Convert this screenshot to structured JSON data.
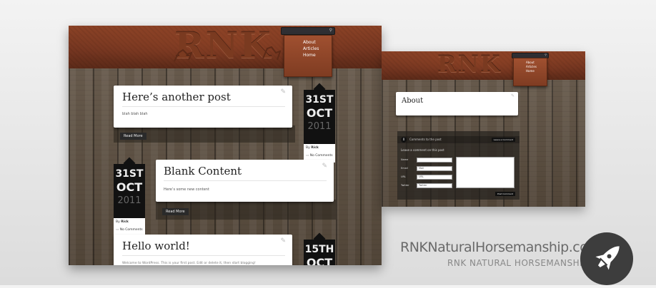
{
  "main_screenshot": {
    "logo": "RNK",
    "search": {
      "placeholder": ""
    },
    "nav": [
      "About",
      "Articles",
      "Home"
    ],
    "posts": [
      {
        "title": "Here’s another post",
        "excerpt": "blah blah blah",
        "read_more": "Read More",
        "date": {
          "day": "31ST",
          "month": "OCT",
          "year": "2011"
        },
        "author_prefix": "By",
        "author": "Rick",
        "comments": "No Comments"
      },
      {
        "title": "Blank Content",
        "excerpt": "Here’s some new content",
        "read_more": "Read More",
        "date": {
          "day": "31ST",
          "month": "OCT",
          "year": "2011"
        },
        "author_prefix": "By",
        "author": "Rick",
        "comments": "No Comments"
      },
      {
        "title": "Hello world!",
        "excerpt": "Welcome to WordPress. This is your first post. Edit or delete it, then start blogging!",
        "date": {
          "day": "15TH",
          "month": "OCT",
          "year": ""
        }
      }
    ]
  },
  "secondary_screenshot": {
    "logo": "RNK",
    "search": {
      "placeholder": "Search this site"
    },
    "nav": [
      "About",
      "Articles",
      "Home"
    ],
    "page_title": "About",
    "comments": {
      "count": "0",
      "heading": "Comments to the post",
      "leave_button": "Leave a Comment",
      "subheading": "Leave a comment on this post",
      "fields": [
        {
          "label": "Name",
          "value": ""
        },
        {
          "label": "Email",
          "value": "Mail"
        },
        {
          "label": "URL",
          "value": "URL"
        },
        {
          "label": "Twitter",
          "value": "Twitter"
        }
      ],
      "submit": "Post Comment"
    }
  },
  "branding": {
    "url": "RNKNaturalHorsemanship.com",
    "subtitle": "RNK NATURAL HORSEMANSHIP",
    "badge_icon": "rocket-icon"
  }
}
